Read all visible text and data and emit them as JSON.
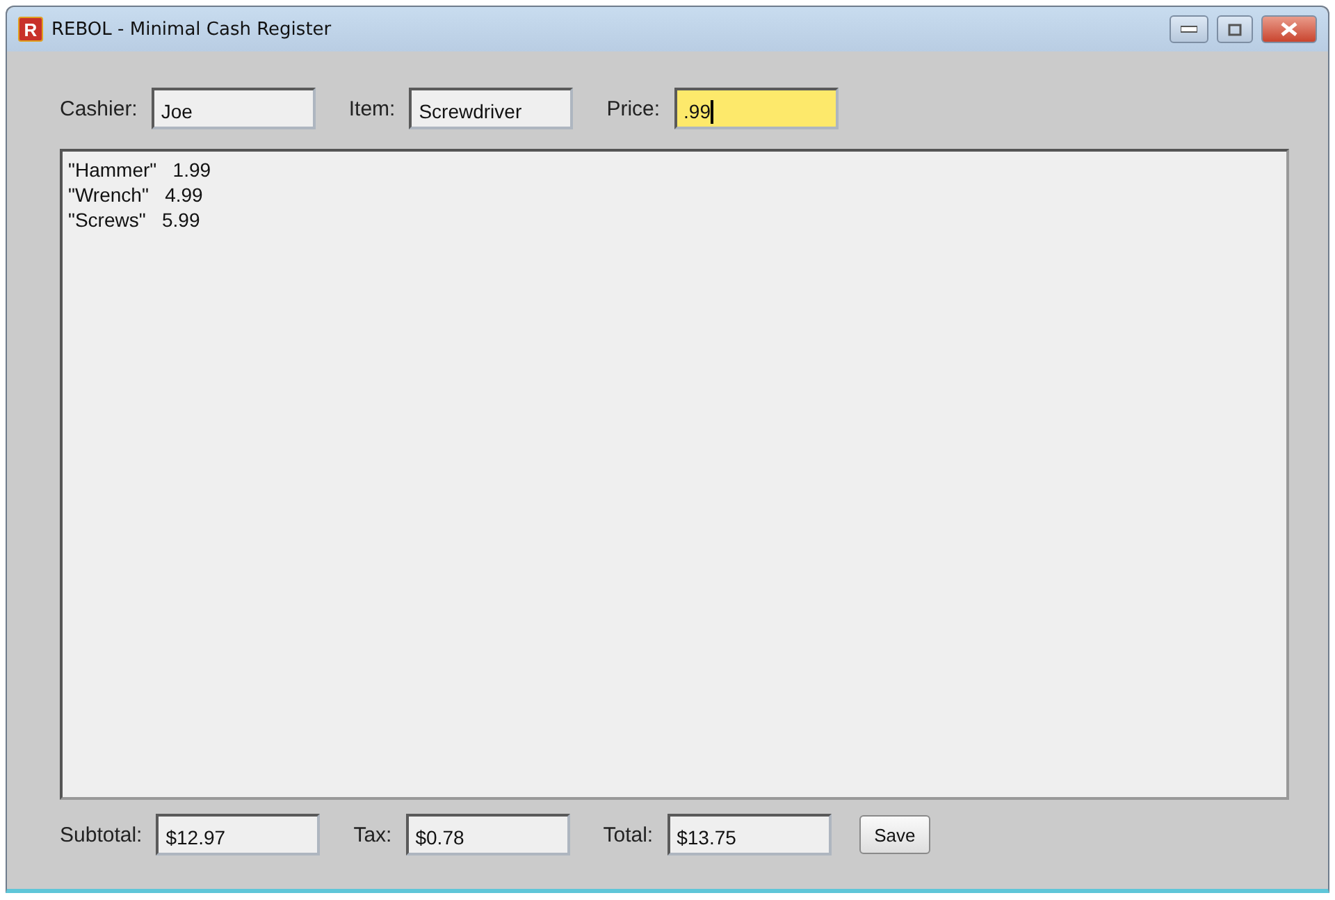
{
  "window": {
    "title": "REBOL - Minimal Cash Register",
    "icon_letter": "R"
  },
  "top_fields": [
    {
      "label": "Cashier:",
      "value": "Joe",
      "focused": false
    },
    {
      "label": "Item:",
      "value": "Screwdriver",
      "focused": false
    },
    {
      "label": "Price:",
      "value": ".99",
      "focused": true
    }
  ],
  "list_lines": [
    "\"Hammer\"   1.99",
    "\"Wrench\"   4.99",
    "\"Screws\"   5.99"
  ],
  "bottom_fields": [
    {
      "label": "Subtotal:",
      "value": "$12.97",
      "focused": false
    },
    {
      "label": "Tax:",
      "value": "$0.78",
      "focused": false
    },
    {
      "label": "Total:",
      "value": "$13.75",
      "focused": false
    }
  ],
  "save_button": "Save"
}
